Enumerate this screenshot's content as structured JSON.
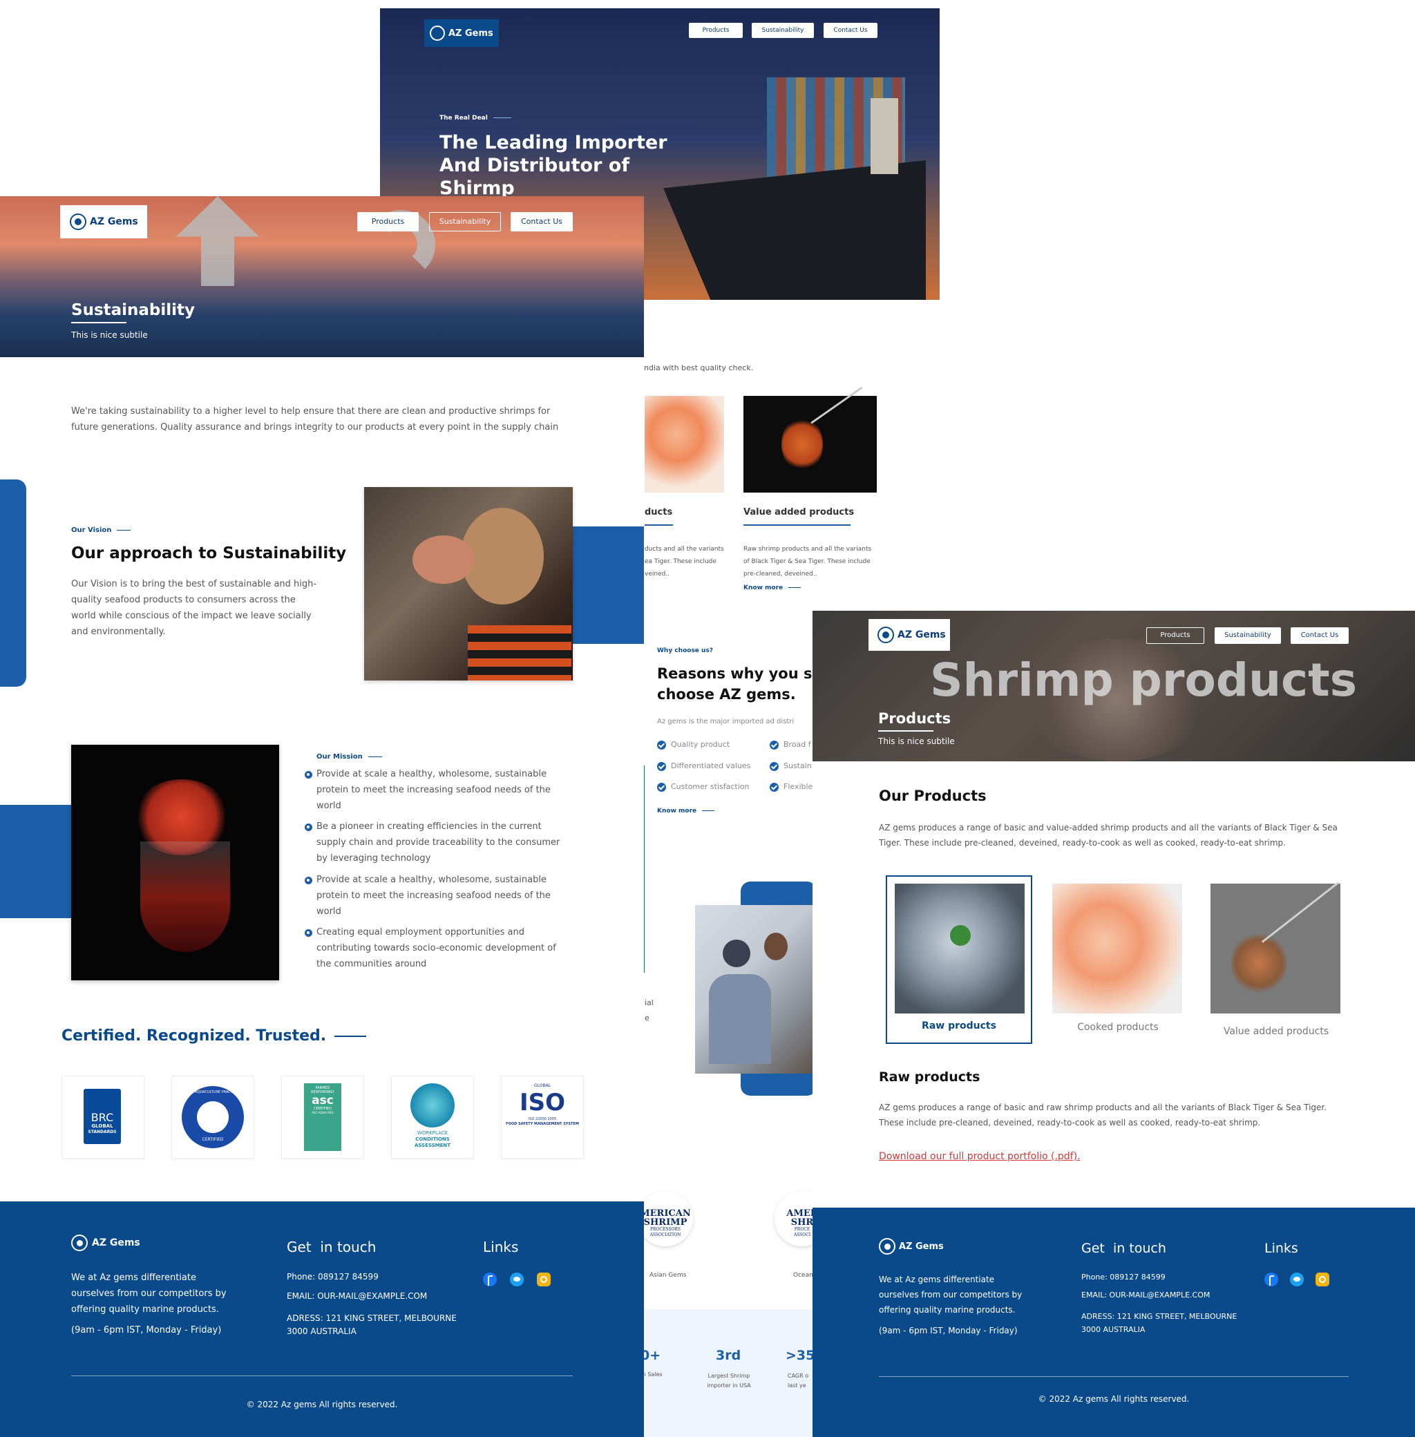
{
  "brand": {
    "name": "AZ Gems",
    "footer_name": "AZ Gems",
    "primary_color": "#0a4a8a",
    "accent_color": "#1a5fa8"
  },
  "nav": {
    "products": "Products",
    "sustainability": "Sustainability",
    "contact": "Contact Us"
  },
  "home": {
    "eyebrow": "The Real Deal",
    "title_line1": "The Leading Importer",
    "title_line2": "And Distributor of",
    "title_line3": "Shirmp",
    "fragment_text": "ndia with best quality check.",
    "card1_title": "ducts",
    "card1_text1": "ducts and all the variants",
    "card1_text2": "ea Tiger. These include",
    "card1_text3": "veined..",
    "card2_title": "Value added products",
    "card2_text1": "Raw shrimp products and all the variants",
    "card2_text2": "of Black Tiger & Sea Tiger. These include",
    "card2_text3": "pre-cleaned, deveined..",
    "know_more": "Know more",
    "why_eyebrow": "Why choose us?",
    "why_title1": "Reasons why you sho",
    "why_title2": "choose AZ gems.",
    "why_desc": "Az gems is the major imported ad distri",
    "reasons": [
      "Quality product",
      "Differentiated values",
      "Customer stisfaction",
      "Broad f",
      "Sustain",
      "Flexible"
    ],
    "why_know_more": "Know more",
    "frag_ial": "ial",
    "frag_e": "e",
    "partner1_caption": "Asian Gems",
    "partner2_caption": "Ocean",
    "partner_logo_line1": "MERICAN",
    "partner_logo_line2": "SHRIMP",
    "partner_logo_line3": "PROCESSORS",
    "partner_logo_line4": "ASSOCIATION",
    "partner2_logo_line1": "AMER",
    "partner2_logo_line2": "SHR",
    "partner2_logo_line3": "PROCE",
    "partner2_logo_line4": "ASSOCI",
    "stat1_value": "0+",
    "stat1_label": "m Sales",
    "stat2_value": "3rd",
    "stat2_label1": "Largest Shrimp",
    "stat2_label2": "importer in USA",
    "stat3_value": ">35",
    "stat3_label1": "CAGR o",
    "stat3_label2": "last ye"
  },
  "sustainability": {
    "hero_title": "Sustainability",
    "hero_subtitle": "This is nice subtile",
    "intro_line1": "We're taking sustainability to a higher level to help ensure that there are clean and productive shrimps for",
    "intro_line2": "future generations. Quality assurance and brings integrity to our products at every point in the supply chain",
    "vision_eyebrow": "Our Vision",
    "vision_title": "Our approach to Sustainability",
    "vision_line1": "Our Vision is to bring the best of sustainable and high-",
    "vision_line2": "quality seafood products to consumers across the",
    "vision_line3": "world while conscious of the impact we leave socially",
    "vision_line4": "and environmentally.",
    "mission_eyebrow": "Our Mission",
    "mission_items": [
      [
        "Provide at scale a healthy, wholesome, sustainable",
        "protein to meet the increasing seafood needs of the",
        "world"
      ],
      [
        "Be a pioneer in creating efficiencies in the current",
        "supply chain and provide traceability to the consumer",
        "by leveraging technology"
      ],
      [
        "Provide at scale a healthy, wholesome, sustainable",
        "protein to meet the increasing seafood needs of the",
        "world"
      ],
      [
        "Creating equal employment opportunities and",
        "contributing towards socio-economic development of",
        "the communities around"
      ]
    ],
    "cert_heading": "Certified. Recognized. Trusted.",
    "certs": [
      {
        "l1": "BRC",
        "l2": "GLOBAL",
        "l3": "STANDARDS"
      },
      {
        "l1": "BEST AQUACULTURE PRACTICES",
        "l2": "CERTIFIED"
      },
      {
        "l1": "FARMED",
        "l2": "RESPONSIBLY",
        "l3": "asc",
        "l4": "CERTIFIED",
        "l5": "ASC-AQUA.ORG"
      },
      {
        "l1": "WORKPLACE",
        "l2": "CONDITIONS",
        "l3": "ASSESSMENT"
      },
      {
        "l1": "GLOBAL",
        "l2": "ISO",
        "l3": "ISO 22000 2005",
        "l4": "FOOD SAFETY MANAGEMENT SYSTEM"
      }
    ]
  },
  "products": {
    "hero_bg_text": "Shrimp products",
    "hero_title": "Products",
    "hero_subtitle": "This is nice subtile",
    "section_title": "Our Products",
    "section_line1": "AZ gems produces a range of basic and value-added shrimp products and all the variants of Black Tiger & Sea",
    "section_line2": "Tiger. These include pre-cleaned, deveined, ready-to-cook as well as cooked, ready-to-eat shrimp.",
    "tabs": [
      "Raw products",
      "Cooked products",
      "Value added products"
    ],
    "raw_title": "Raw products",
    "raw_line1": "AZ gems produces a range of basic and raw shrimp products and all the variants of Black Tiger & Sea Tiger.",
    "raw_line2": "These include pre-cleaned, deveined, ready-to-cook as well as cooked, ready-to-eat shrimp.",
    "download_link": "Download our full product portfolio (.pdf)."
  },
  "footer": {
    "about_line1": "We at Az gems differentiate",
    "about_line2": "ourselves from our competitors by",
    "about_line3": "offering quality marine products.",
    "hours": "(9am - 6pm IST, Monday - Friday)",
    "get_in_touch": "Get  in touch",
    "phone": "Phone: 089127 84599",
    "email": "EMAIL: OUR-MAIL@EXAMPLE.COM",
    "address_line1": "ADRESS: 121 KING STREET, MELBOURNE",
    "address_line2": "3000 AUSTRALIA",
    "links_title": "Links",
    "copyright": "© 2022 Az gems All rights reserved."
  }
}
